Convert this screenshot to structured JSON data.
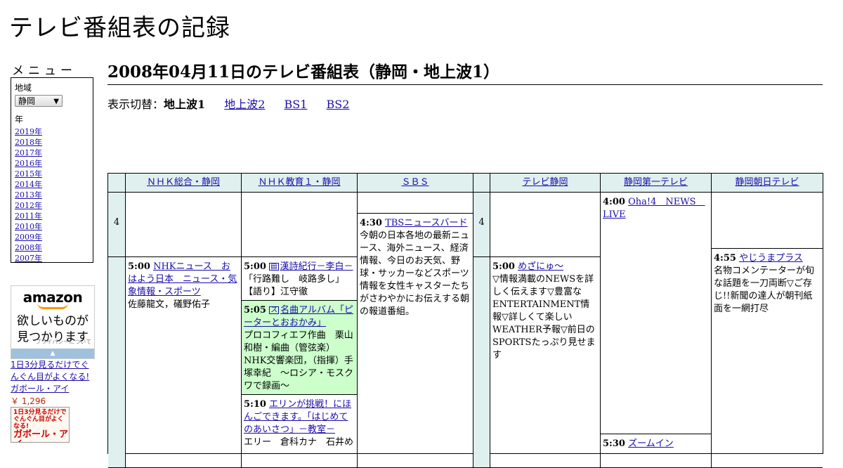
{
  "site_title": "テレビ番組表の記録",
  "menu": {
    "heading": "メニュー",
    "region_label": "地域",
    "region_value": "静岡",
    "year_label": "年",
    "years": [
      "2019年",
      "2018年",
      "2017年",
      "2016年",
      "2015年",
      "2014年",
      "2013年",
      "2012年",
      "2011年",
      "2010年",
      "2009年",
      "2008年",
      "2007年"
    ]
  },
  "ad": {
    "logo": "amazon",
    "message_line1": "欲しいものが",
    "message_line2": "見つかります",
    "privacy": "プライバシーについて",
    "product_title": "1日3分見るだけでぐんぐん目がよくなる! ガボール・アイ",
    "price": "￥ 1,296",
    "thumb_line1": "1日3分見るだけでぐんぐん目がよくなる!",
    "thumb_line2": "ガボール・アイ"
  },
  "page_heading": "2008年04月11日のテレビ番組表（静岡・地上波1）",
  "switcher": {
    "label": "表示切替：",
    "current": "地上波1",
    "links": [
      "地上波2",
      "BS1",
      "BS2"
    ]
  },
  "channels": [
    "ＮＨＫ総合・静岡",
    "ＮＨＫ教育１・静岡",
    "ＳＢＳ",
    "テレビ静岡",
    "静岡第一テレビ",
    "静岡朝日テレビ"
  ],
  "hours": [
    "4",
    "4"
  ],
  "programs": {
    "nhk_g_500": {
      "time": "5:00",
      "title": "NHKニュース　おはよう日本　ニュース・気象情報・スポーツ",
      "desc": "佐藤龍文，礒野佑子"
    },
    "nhk_e_500": {
      "time": "5:00",
      "title": "漢詩紀行－李白－",
      "desc": "「行路難し　岐路多し」【語り】江守徹"
    },
    "nhk_e_505": {
      "time": "5:05",
      "title": "名曲アルバム「ピーターとおおかみ」",
      "desc": "プロコフィエフ作曲　栗山和樹・編曲（管弦楽）NHK交響楽団，（指揮）手塚幸紀　～ロシア・モスクワで録画～"
    },
    "nhk_e_510": {
      "time": "5:10",
      "title": "エリンが挑戦！にほんごできます。「はじめてのあいさつ」－教室－",
      "desc": "エリー　倉科カナ　石井め"
    },
    "sbs_430": {
      "time": "4:30",
      "title": "TBSニュースバード",
      "desc": "今朝の日本各地の最新ニュース、海外ニュース、経済情報、今日のお天気、野球・サッカーなどスポーツ情報を女性キャスターたちがさわやかにお伝えする朝の報道番組。"
    },
    "sut_500": {
      "time": "5:00",
      "title": "めざにゅ～",
      "desc": "▽情報満載のNEWSを詳しく伝えます▽豊富なENTERTAINMENT情報▽詳しくて楽しいWEATHER予報▽前日のSPORTSたっぷり見せます"
    },
    "sdt_400": {
      "time": "4:00",
      "title": "Oha!4　NEWS　LIVE",
      "desc": ""
    },
    "sdt_530": {
      "time": "5:30",
      "title": "ズームイン",
      "desc": ""
    },
    "satv_455": {
      "time": "4:55",
      "title": "やじうまプラス",
      "desc": "名物コメンテーターが旬な話題を一刀両断▽ご存じ!!新聞の達人が朝刊紙面を一網打尽"
    }
  },
  "colors": {
    "header_bg": "#dff0ee",
    "highlight_bg": "#ccffcc",
    "link": "#1a0dab"
  }
}
